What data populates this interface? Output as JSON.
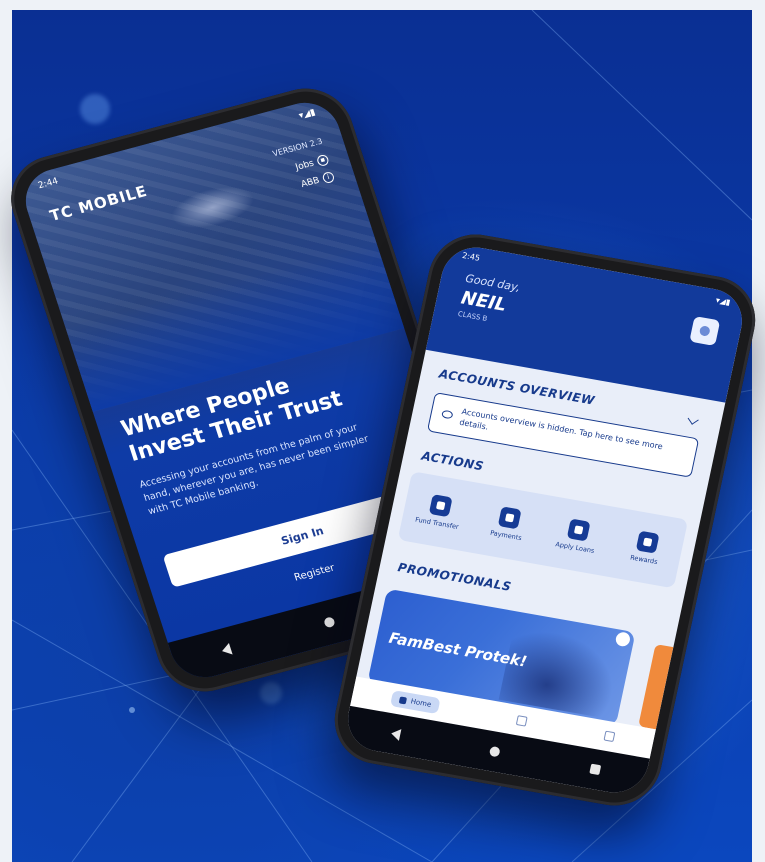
{
  "left_phone": {
    "status_time": "2:44",
    "brand": "TC MOBILE",
    "version": "VERSION 2.3",
    "links": [
      {
        "label": "Jobs",
        "icon": "briefcase-icon"
      },
      {
        "label": "ABB",
        "icon": "info-icon"
      }
    ],
    "headline": "Where People Invest Their Trust",
    "subtext": "Accessing your accounts from the palm of your hand, wherever you are, has never been simpler with TC Mobile banking.",
    "sign_in_label": "Sign In",
    "register_label": "Register"
  },
  "right_phone": {
    "status_time": "2:45",
    "greeting": "Good day,",
    "user_name": "NEIL",
    "user_class": "CLASS B",
    "accounts_title": "ACCOUNTS OVERVIEW",
    "accounts_hidden_text": "Accounts overview is hidden. Tap here to see more details.",
    "actions_title": "ACTIONS",
    "actions": [
      {
        "label": "Fund Transfer",
        "icon": "transfer-icon"
      },
      {
        "label": "Payments",
        "icon": "payments-icon"
      },
      {
        "label": "Apply Loans",
        "icon": "loan-icon"
      },
      {
        "label": "Rewards",
        "icon": "gift-icon"
      }
    ],
    "promotionals_title": "PROMOTIONALS",
    "promo_title": "FamBest Protek!",
    "tab_home": "Home"
  },
  "colors": {
    "primary_blue": "#123a9b",
    "background_blue": "#0b3aa8",
    "accent_orange": "#f08a3c"
  }
}
